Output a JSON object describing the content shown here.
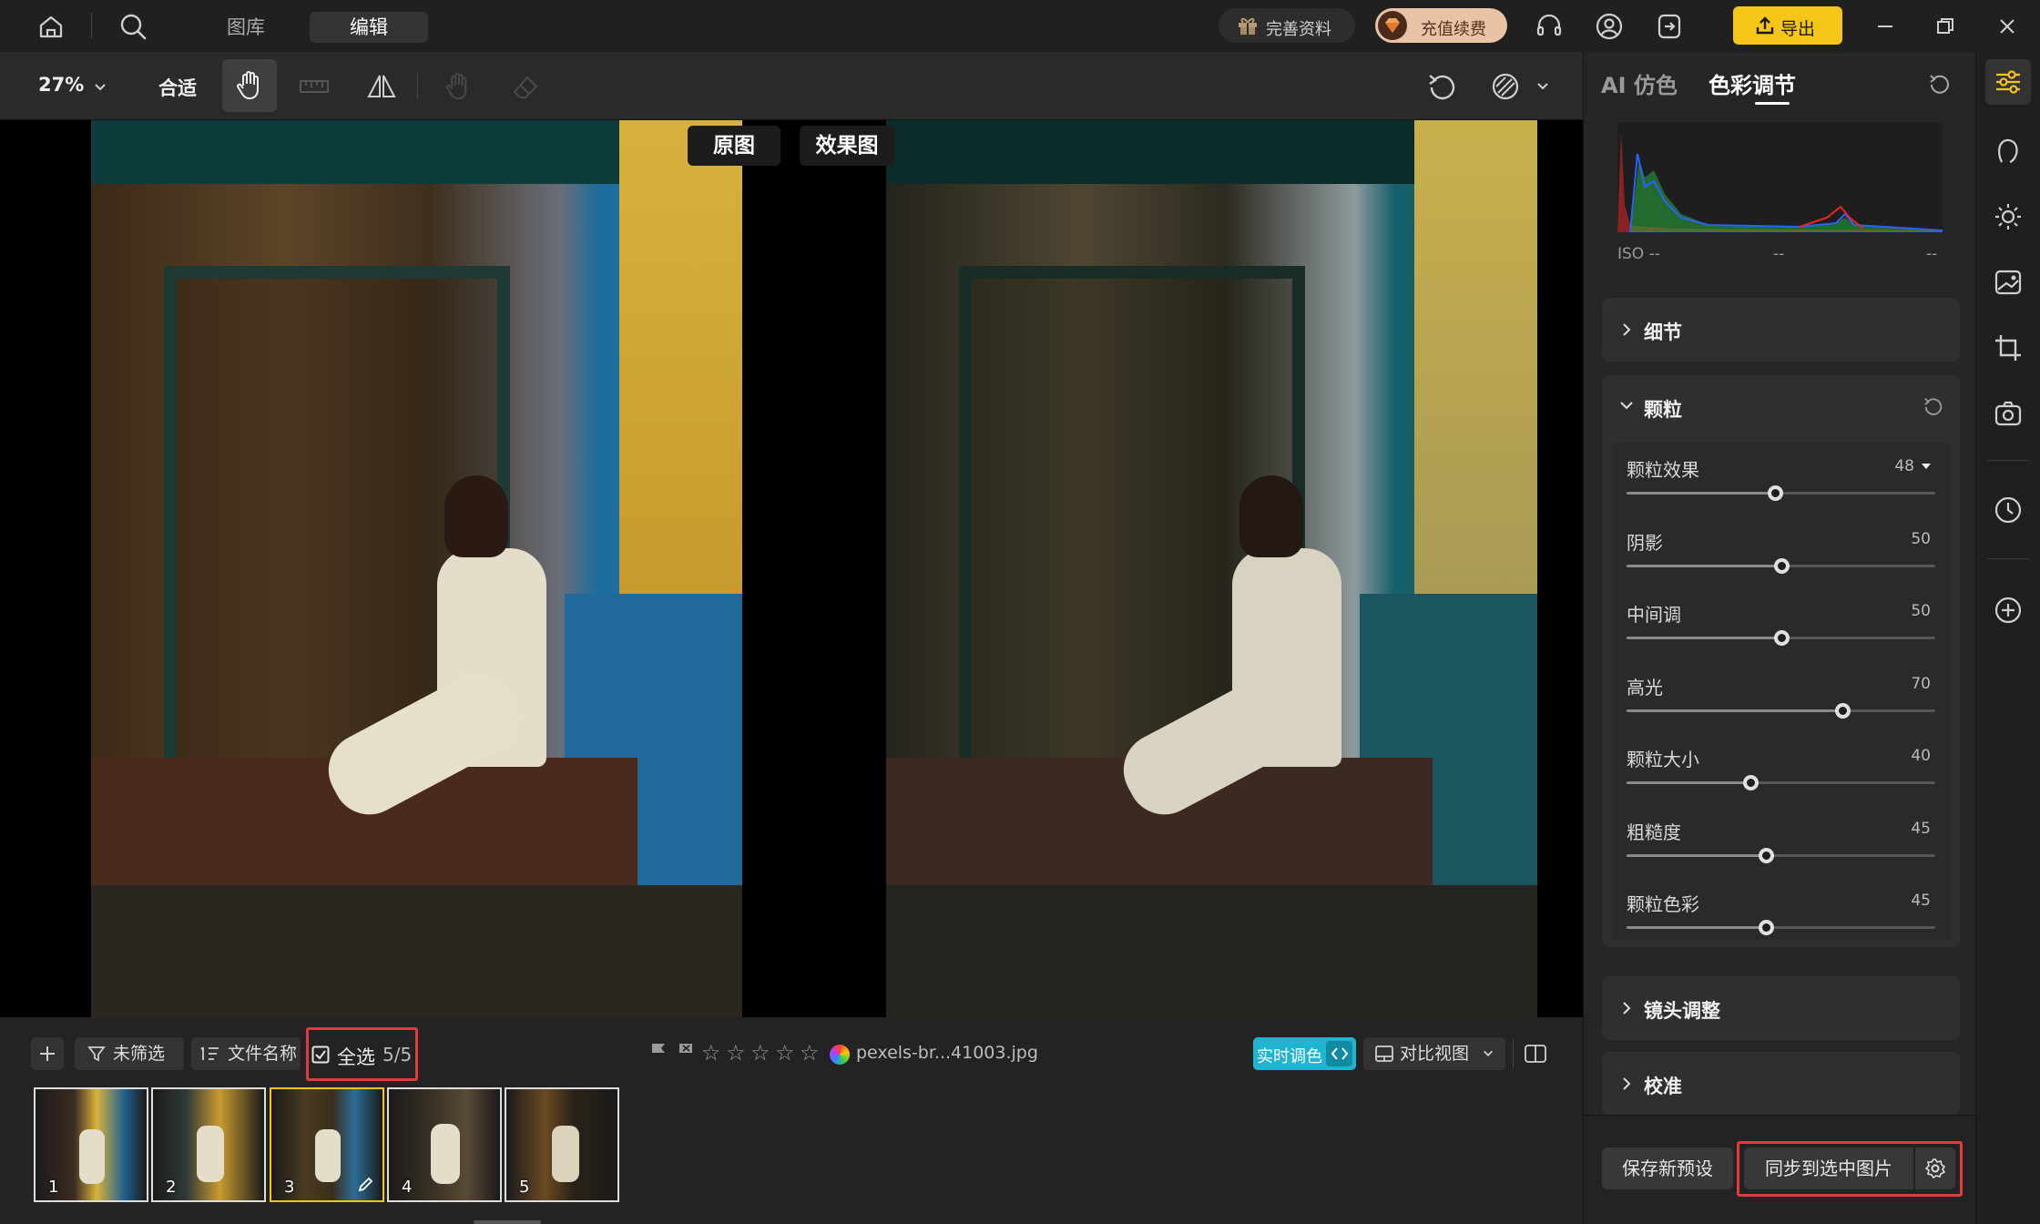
{
  "topbar": {
    "tabs": [
      "图库",
      "编辑"
    ],
    "active_tab": "编辑",
    "complete_profile": "完善资料",
    "recharge": "充值续费",
    "export": "导出"
  },
  "toolbar": {
    "zoom": "27%",
    "fit": "合适"
  },
  "canvas": {
    "label_original": "原图",
    "label_effect": "效果图"
  },
  "panel": {
    "tab_ai": "AI 仿色",
    "tab_color": "色彩调节",
    "iso": "ISO --",
    "iso_mid": "--",
    "iso_right": "--",
    "section_detail": "细节",
    "section_grain": "颗粒",
    "section_lens": "镜头调整",
    "section_calibrate": "校准",
    "sliders": [
      {
        "label": "颗粒效果",
        "value": "48",
        "pos": 0.48
      },
      {
        "label": "阴影",
        "value": "50",
        "pos": 0.5
      },
      {
        "label": "中间调",
        "value": "50",
        "pos": 0.5
      },
      {
        "label": "高光",
        "value": "70",
        "pos": 0.7
      },
      {
        "label": "颗粒大小",
        "value": "40",
        "pos": 0.4
      },
      {
        "label": "粗糙度",
        "value": "45",
        "pos": 0.45
      },
      {
        "label": "颗粒色彩",
        "value": "45",
        "pos": 0.45
      }
    ],
    "save_preset": "保存新预设",
    "sync_selected": "同步到选中图片"
  },
  "bottom": {
    "filter": "未筛选",
    "sort": "文件名称",
    "select_all": "全选",
    "select_count": "5/5",
    "filename": "pexels-br...41003.jpg",
    "realtime": "实时调色",
    "compare_view": "对比视图",
    "thumbs": [
      "1",
      "2",
      "3",
      "4",
      "5"
    ]
  },
  "colors": {
    "accent_yellow": "#f5c518",
    "highlight_red": "#e23b3b",
    "realtime_cyan": "#1fb5d1"
  }
}
